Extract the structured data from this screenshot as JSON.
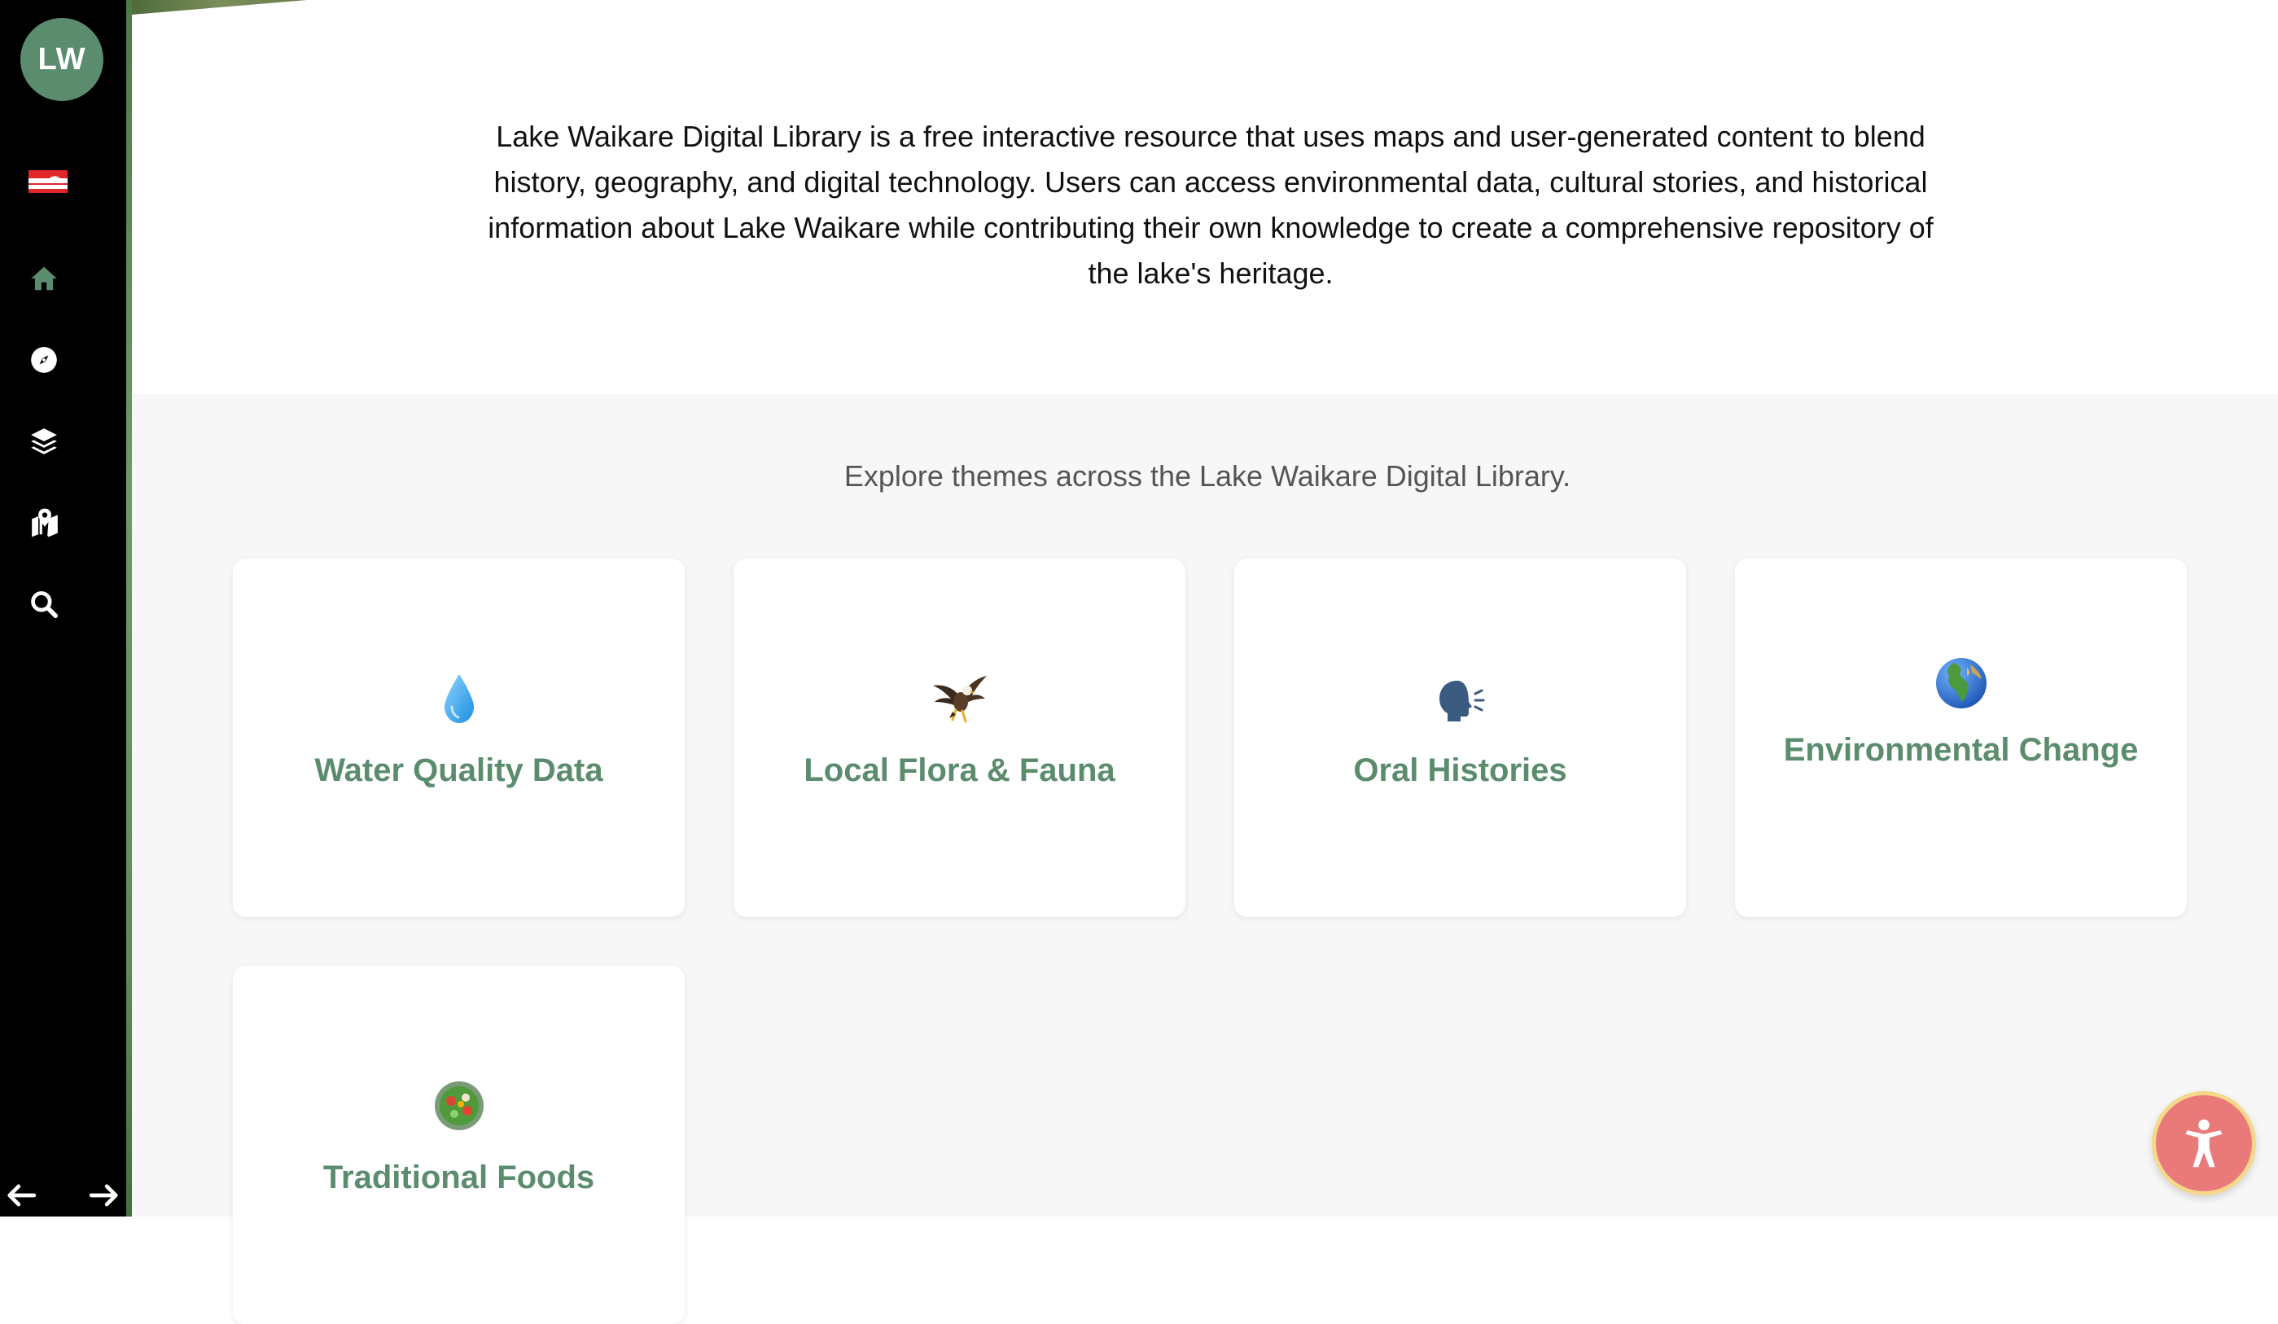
{
  "sidebar": {
    "avatar_initials": "LW",
    "flag_icon": "tino-rangatiratanga-flag-icon",
    "nav_items": [
      {
        "icon": "home-icon",
        "color": "#5b8c6d"
      },
      {
        "icon": "compass-icon",
        "color": "#ffffff"
      },
      {
        "icon": "layers-icon",
        "color": "#ffffff"
      },
      {
        "icon": "map-marker-icon",
        "color": "#ffffff"
      },
      {
        "icon": "search-icon",
        "color": "#ffffff"
      }
    ],
    "back_icon": "arrow-left-icon",
    "forward_icon": "arrow-right-icon"
  },
  "intro": {
    "text": "Lake Waikare Digital Library is a free interactive resource that uses maps and user-generated content to blend history, geography, and digital technology. Users can access environmental data, cultural stories, and historical information about Lake Waikare while contributing their own knowledge to create a comprehensive repository of the lake's heritage."
  },
  "themes": {
    "heading": "Explore themes across the Lake Waikare Digital Library.",
    "cards": [
      {
        "icon": "water-drop-icon",
        "emoji": "💧",
        "title": "Water Quality Data"
      },
      {
        "icon": "eagle-icon",
        "emoji": "🦅",
        "title": "Local Flora & Fauna"
      },
      {
        "icon": "speaking-head-icon",
        "emoji": "🗣️",
        "title": "Oral Histories"
      },
      {
        "icon": "globe-icon",
        "emoji": "🌍",
        "title": "Environmental Change"
      },
      {
        "icon": "salad-bowl-icon",
        "emoji": "🥗",
        "title": "Traditional Foods"
      }
    ]
  },
  "colors": {
    "accent": "#5b8c6d",
    "sidebar_bg": "#000000",
    "themes_bg": "#f7f7f7",
    "a11y_button": "#ea7a7a"
  },
  "accessibility_button_icon": "accessibility-person-icon"
}
